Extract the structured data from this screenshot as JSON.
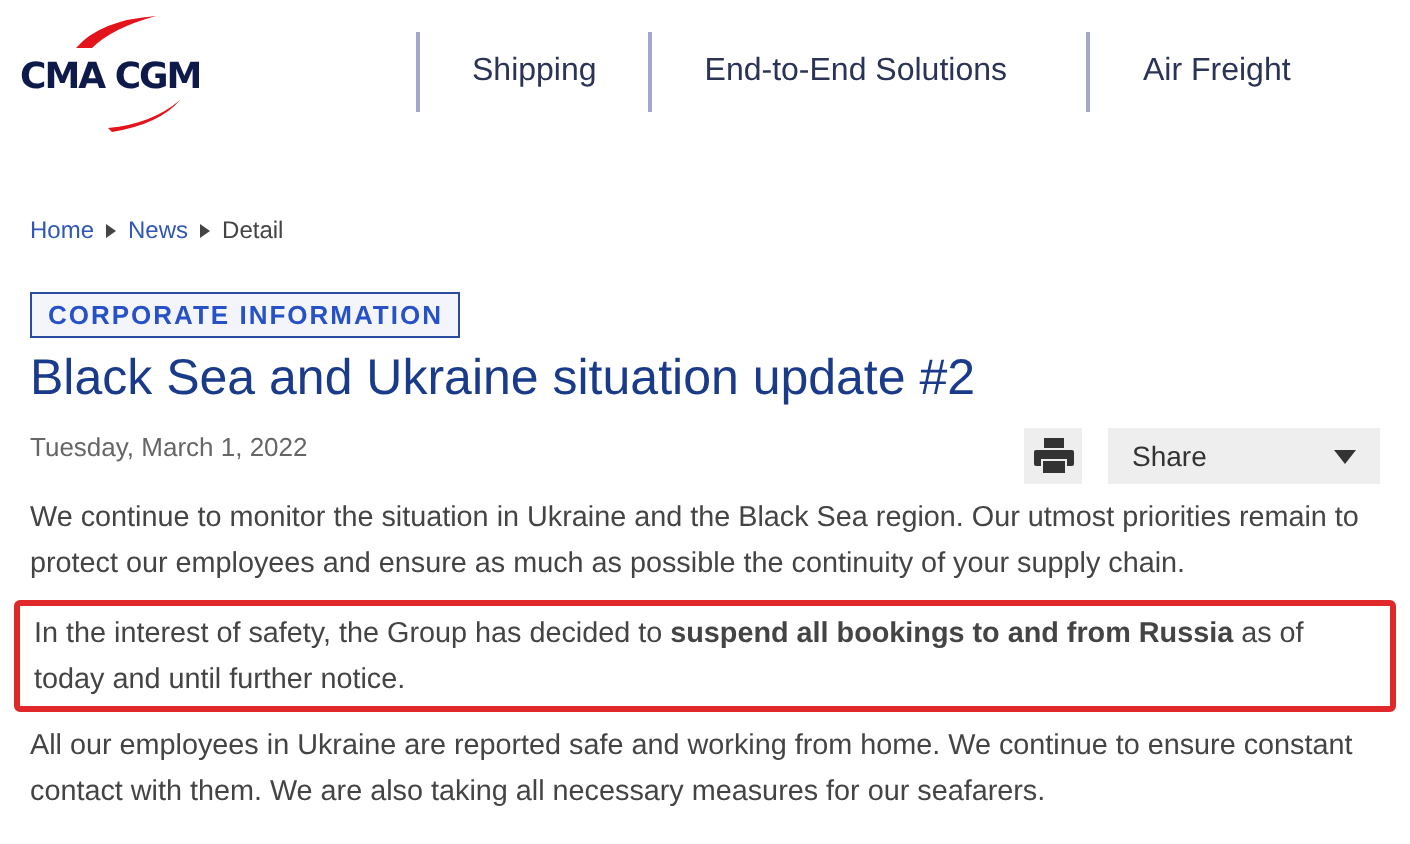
{
  "logo": {
    "text": "CMA CGM"
  },
  "nav": [
    {
      "label": "Shipping"
    },
    {
      "label": "End-to-End Solutions"
    },
    {
      "label": "Air Freight"
    }
  ],
  "breadcrumb": [
    {
      "label": "Home",
      "link": true
    },
    {
      "label": "News",
      "link": true
    },
    {
      "label": "Detail",
      "link": false
    }
  ],
  "tag": "CORPORATE INFORMATION",
  "title": "Black Sea and Ukraine situation update #2",
  "date": "Tuesday, March 1, 2022",
  "share": {
    "label": "Share"
  },
  "paragraphs": [
    {
      "text": "We continue to monitor the situation in Ukraine and the Black Sea region. Our utmost priorities remain to protect our employees and ensure as much as possible the continuity of your supply chain.",
      "highlighted": false
    },
    {
      "text": "In the interest of safety, the Group has decided to **suspend all bookings to and from Russia** as of today and until further notice.",
      "highlighted": true
    },
    {
      "text": "All our employees in Ukraine are reported safe and working from home. We continue to ensure constant contact with them. We are also taking all necessary measures for our seafarers.",
      "highlighted": false
    }
  ]
}
